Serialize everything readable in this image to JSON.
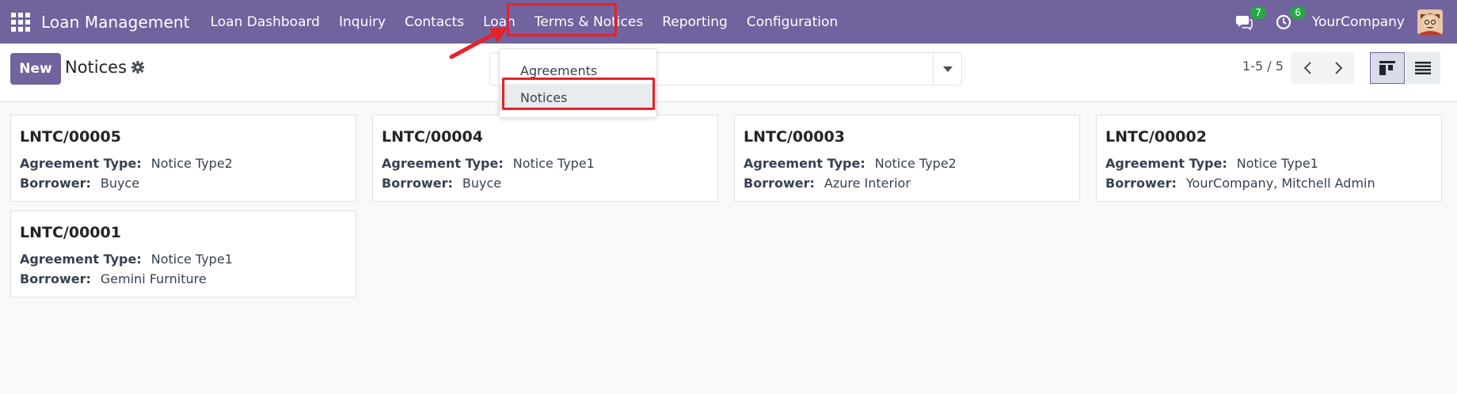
{
  "navbar": {
    "brand": "Loan Management",
    "items": [
      {
        "label": "Loan Dashboard"
      },
      {
        "label": "Inquiry"
      },
      {
        "label": "Contacts"
      },
      {
        "label": "Loan"
      },
      {
        "label": "Terms & Notices"
      },
      {
        "label": "Reporting"
      },
      {
        "label": "Configuration"
      }
    ],
    "messages_badge": "7",
    "activities_badge": "6",
    "company": "YourCompany"
  },
  "control": {
    "new_label": "New",
    "title": "Notices",
    "pager": "1-5 / 5"
  },
  "dropdown": {
    "items": [
      {
        "label": "Agreements"
      },
      {
        "label": "Notices"
      }
    ]
  },
  "cards": [
    {
      "ref": "LNTC/00005",
      "type_label": "Agreement Type:",
      "type": "Notice Type2",
      "borrower_label": "Borrower:",
      "borrower": "Buyce"
    },
    {
      "ref": "LNTC/00004",
      "type_label": "Agreement Type:",
      "type": "Notice Type1",
      "borrower_label": "Borrower:",
      "borrower": "Buyce"
    },
    {
      "ref": "LNTC/00003",
      "type_label": "Agreement Type:",
      "type": "Notice Type2",
      "borrower_label": "Borrower:",
      "borrower": "Azure Interior"
    },
    {
      "ref": "LNTC/00002",
      "type_label": "Agreement Type:",
      "type": "Notice Type1",
      "borrower_label": "Borrower:",
      "borrower": "YourCompany, Mitchell Admin"
    },
    {
      "ref": "LNTC/00001",
      "type_label": "Agreement Type:",
      "type": "Notice Type1",
      "borrower_label": "Borrower:",
      "borrower": "Gemini Furniture"
    }
  ],
  "colors": {
    "brand": "#71639e",
    "annotation": "#e8202a",
    "badge": "#28a745"
  }
}
